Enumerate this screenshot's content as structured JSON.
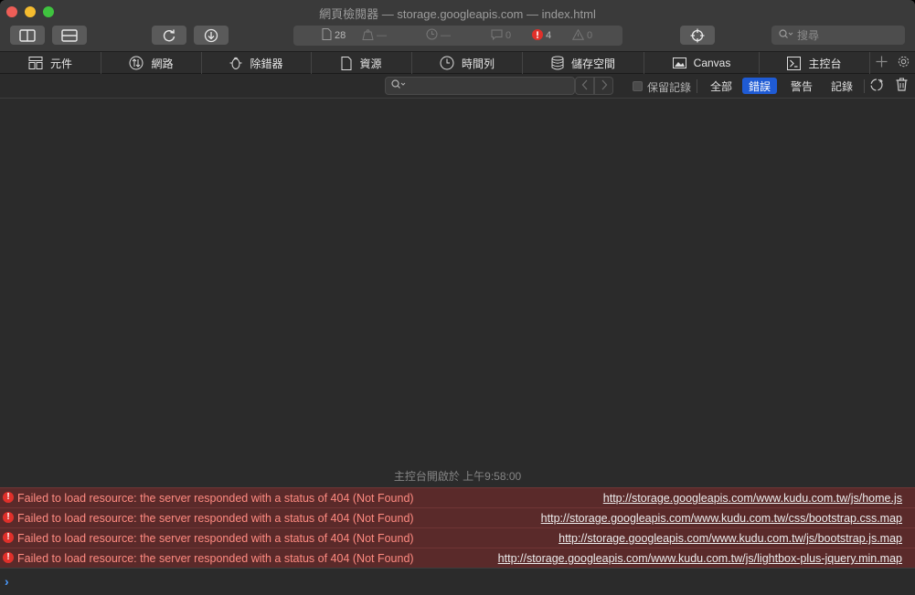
{
  "window": {
    "title": "網頁檢閱器 — storage.googleapis.com — index.html"
  },
  "toolbar": {
    "dock_side_icon": "sidebar-icon",
    "dock_bottom_icon": "bottom-dock-icon",
    "reload_icon": "reload-icon",
    "download_icon": "download-icon",
    "target_icon": "crosshair-icon",
    "stats": {
      "resources": "28",
      "load_weight": "—",
      "load_time": "—",
      "logs": "0",
      "errors": "4",
      "warnings": "0"
    },
    "search_placeholder": "搜尋"
  },
  "tabs": [
    {
      "label": "元件",
      "icon": "elements-icon"
    },
    {
      "label": "網路",
      "icon": "network-icon"
    },
    {
      "label": "除錯器",
      "icon": "debugger-bug-icon"
    },
    {
      "label": "資源",
      "icon": "resources-document-icon"
    },
    {
      "label": "時間列",
      "icon": "timeline-clock-icon"
    },
    {
      "label": "儲存空間",
      "icon": "storage-database-icon"
    },
    {
      "label": "Canvas",
      "icon": "canvas-image-icon"
    },
    {
      "label": "主控台",
      "icon": "console-icon"
    }
  ],
  "filter": {
    "placeholder": "",
    "preserve_log_label": "保留記錄",
    "levels": [
      {
        "label": "全部",
        "active": false
      },
      {
        "label": "錯誤",
        "active": true
      },
      {
        "label": "警告",
        "active": false
      },
      {
        "label": "記錄",
        "active": false
      }
    ]
  },
  "console": {
    "session_text": "主控台開啟於 上午9:58:00",
    "messages": [
      {
        "level": "error",
        "text": "Failed to load resource: the server responded with a status of 404 (Not Found)",
        "url": "http://storage.googleapis.com/www.kudu.com.tw/js/home.js"
      },
      {
        "level": "error",
        "text": "Failed to load resource: the server responded with a status of 404 (Not Found)",
        "url": "http://storage.googleapis.com/www.kudu.com.tw/css/bootstrap.css.map"
      },
      {
        "level": "error",
        "text": "Failed to load resource: the server responded with a status of 404 (Not Found)",
        "url": "http://storage.googleapis.com/www.kudu.com.tw/js/bootstrap.js.map"
      },
      {
        "level": "error",
        "text": "Failed to load resource: the server responded with a status of 404 (Not Found)",
        "url": "http://storage.googleapis.com/www.kudu.com.tw/js/lightbox-plus-jquery.min.map"
      }
    ],
    "prompt_value": ""
  },
  "colors": {
    "error": "#e0302a",
    "error_text": "#ff8a80",
    "active_filter": "#1f5bd4",
    "prompt_caret": "#4a9bff"
  }
}
